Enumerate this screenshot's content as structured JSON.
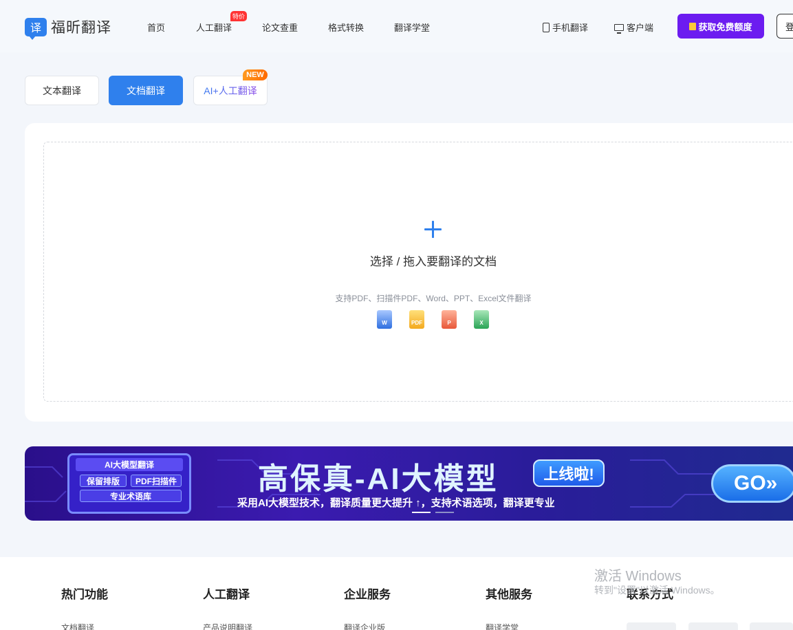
{
  "header": {
    "logo_glyph": "译",
    "logo_text": "福昕翻译",
    "nav": [
      {
        "label": "首页"
      },
      {
        "label": "人工翻译",
        "badge": "特价"
      },
      {
        "label": "论文查重"
      },
      {
        "label": "格式转换"
      },
      {
        "label": "翻译学堂"
      }
    ],
    "mobile_label": "手机翻译",
    "client_label": "客户端",
    "free_btn": "获取免费额度",
    "login_btn": "登"
  },
  "tabs": {
    "text": "文本翻译",
    "doc": "文档翻译",
    "ai": "AI+人工翻译",
    "new_badge": "NEW"
  },
  "upload": {
    "title": "选择 / 拖入要翻译的文档",
    "subtitle": "支持PDF、扫描件PDF、Word、PPT、Excel文件翻译",
    "file_types": [
      {
        "icon": "word-file-icon",
        "label": "W"
      },
      {
        "icon": "pdf-file-icon",
        "label": "PDF"
      },
      {
        "icon": "ppt-file-icon",
        "label": "P"
      },
      {
        "icon": "excel-file-icon",
        "label": "X"
      }
    ]
  },
  "banner": {
    "box_title": "AI大模型翻译",
    "chips": [
      "保留排版",
      "PDF扫描件",
      "专业术语库"
    ],
    "headline": "高保真-AI大模型",
    "tag": "上线啦!",
    "subline": "采用AI大模型技术，翻译质量更大提升 ↑，支持术语选项，翻译更专业",
    "go": "GO»"
  },
  "footer": {
    "columns": [
      {
        "title": "热门功能",
        "first_link": "文档翻译"
      },
      {
        "title": "人工翻译",
        "first_link": "产品说明翻译"
      },
      {
        "title": "企业服务",
        "first_link": "翻译企业版"
      },
      {
        "title": "其他服务",
        "first_link": "翻译学堂"
      },
      {
        "title": "联系方式"
      }
    ]
  },
  "watermark": {
    "line1": "激活 Windows",
    "line2": "转到\"设置\"以激活 Windows。"
  }
}
